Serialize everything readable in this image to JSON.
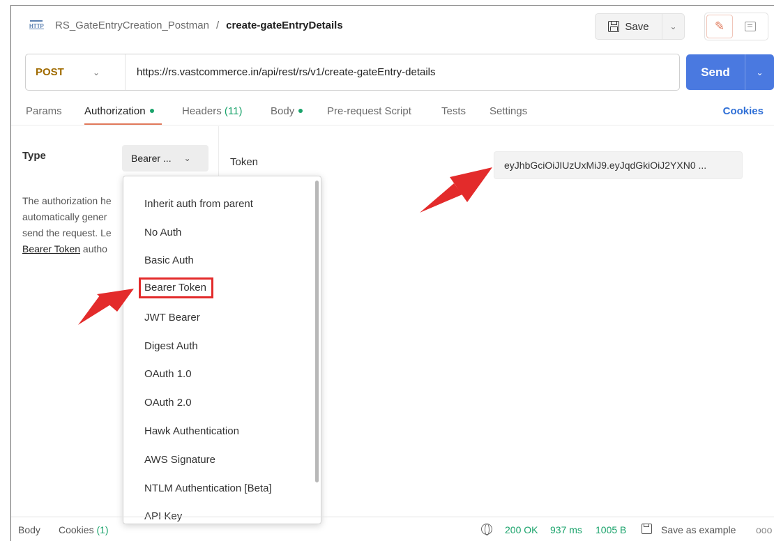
{
  "header": {
    "collection": "RS_GateEntryCreation_Postman",
    "separator": "/",
    "request_name": "create-gateEntryDetails",
    "http_icon_label": "HTTP",
    "save_label": "Save"
  },
  "request": {
    "method": "POST",
    "url": "https://rs.vastcommerce.in/api/rest/rs/v1/create-gateEntry-details",
    "send_label": "Send"
  },
  "tabs": {
    "params": "Params",
    "authorization": "Authorization",
    "headers": "Headers",
    "headers_count": "(11)",
    "body": "Body",
    "prerequest": "Pre-request Script",
    "tests": "Tests",
    "settings": "Settings",
    "cookies": "Cookies"
  },
  "auth": {
    "type_label": "Type",
    "selected_type": "Bearer ...",
    "desc_line1": "The authorization he",
    "desc_line2": "automatically gener",
    "desc_line3": "send the request. Le",
    "desc_link": "Bearer Token",
    "desc_line4_rest": " autho",
    "token_label": "Token",
    "token_value": "eyJhbGciOiJIUzUxMiJ9.eyJqdGkiOiJ2YXN0 ..."
  },
  "dropdown": {
    "items": [
      "Inherit auth from parent",
      "No Auth",
      "Basic Auth",
      "Bearer Token",
      "JWT Bearer",
      "Digest Auth",
      "OAuth 1.0",
      "OAuth 2.0",
      "Hawk Authentication",
      "AWS Signature",
      "NTLM Authentication [Beta]",
      "API Key"
    ],
    "highlighted": "Bearer Token"
  },
  "status_bar": {
    "body": "Body",
    "cookies": "Cookies",
    "cookies_count": "(1)",
    "status": "200 OK",
    "time": "937 ms",
    "size": "1005 B",
    "save_example": "Save as example",
    "more": "ooo"
  },
  "colors": {
    "accent_blue": "#4a79e0",
    "method_post": "#a06b00",
    "success_green": "#1aa36b",
    "tab_underline": "#e0785a",
    "annotation_red": "#e32b2b"
  }
}
